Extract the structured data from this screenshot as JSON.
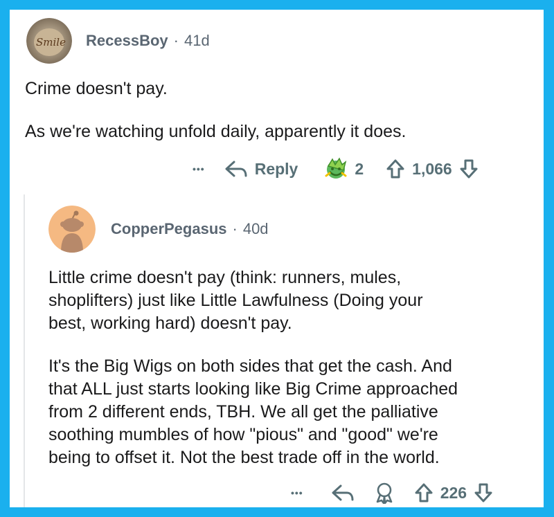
{
  "comment1": {
    "username": "RecessBoy",
    "separator": "·",
    "age": "41d",
    "paragraphs": [
      "Crime doesn't pay.",
      "As we're watching unfold daily, apparently it does."
    ],
    "actions": {
      "more": "•••",
      "reply_label": "Reply",
      "award_count": "2",
      "score": "1,066"
    }
  },
  "comment2": {
    "username": "CopperPegasus",
    "separator": "·",
    "age": "40d",
    "lines_p1": [
      "Little crime doesn't pay (think: runners, mules,",
      "shoplifters) just like Little Lawfulness (Doing your",
      "best, working hard) doesn't pay."
    ],
    "lines_p2": [
      "It's the Big Wigs on both sides that get the cash. And",
      "that ALL just starts looking like Big Crime approached",
      "from 2 different ends, TBH. We all get the palliative",
      "soothing mumbles of how \"pious\" and \"good\" we're",
      "being to offset it. Not the best trade off in the world."
    ],
    "actions": {
      "more": "•••",
      "score": "226"
    }
  },
  "colors": {
    "frame": "#1ab0ee",
    "meta_text": "#5a6672",
    "body_text": "#1a1a1b",
    "action_icon": "#576f76",
    "snoo_bg": "#f5b982"
  },
  "icons": {
    "more": "ellipsis-icon",
    "reply": "reply-arrow-icon",
    "award": "award-icon",
    "upvote": "upvote-arrow-icon",
    "downvote": "downvote-arrow-icon"
  }
}
